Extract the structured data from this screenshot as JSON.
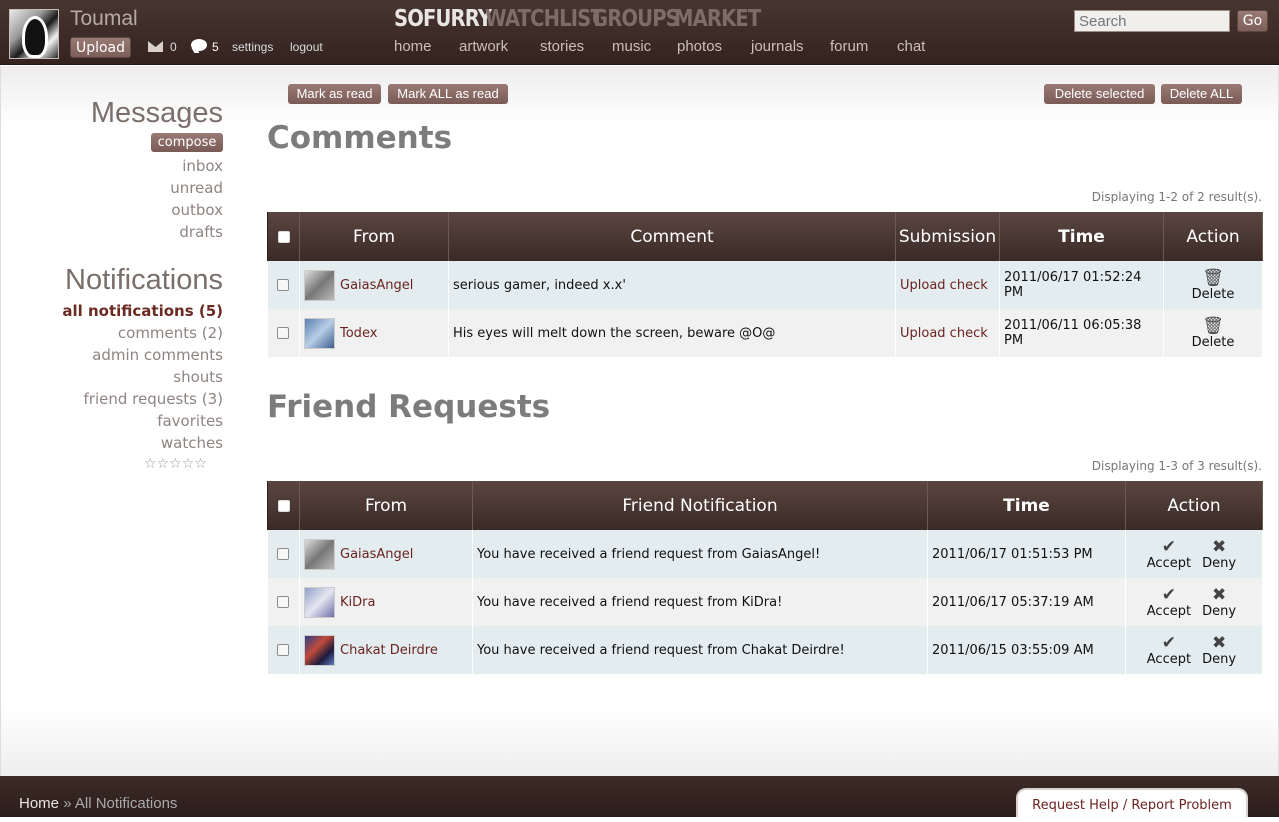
{
  "header": {
    "username": "Toumal",
    "upload_label": "Upload",
    "mail_count": "0",
    "comment_count": "5",
    "settings_label": "settings",
    "logout_label": "logout",
    "brand_nav": [
      "SOFURRY",
      "WATCHLIST",
      "GROUPS",
      "MARKET"
    ],
    "sub_nav": [
      "home",
      "artwork",
      "stories",
      "music",
      "photos",
      "journals",
      "forum",
      "chat"
    ],
    "search_placeholder": "Search",
    "go_label": "Go"
  },
  "sidebar": {
    "messages_title": "Messages",
    "compose_label": "compose",
    "message_links": [
      "inbox",
      "unread",
      "outbox",
      "drafts"
    ],
    "notifications_title": "Notifications",
    "notification_links": [
      "all notifications (5)",
      "comments (2)",
      "admin comments",
      "shouts",
      "friend requests (3)",
      "favorites",
      "watches"
    ],
    "rating": "☆☆☆☆☆"
  },
  "toolbar": {
    "mark_read": "Mark as read",
    "mark_all_read": "Mark ALL as read",
    "delete_selected": "Delete selected",
    "delete_all": "Delete ALL"
  },
  "comments": {
    "title": "Comments",
    "displaying": "Displaying 1-2 of 2 result(s).",
    "headers": [
      "From",
      "Comment",
      "Submission",
      "Time",
      "Action"
    ],
    "rows": [
      {
        "from": "GaiasAngel",
        "comment": "serious gamer, indeed x.x'",
        "submission": "Upload check",
        "time": "2011/06/17 01:52:24 PM",
        "action": "Delete"
      },
      {
        "from": "Todex",
        "comment": "His eyes will melt down the screen, beware @O@",
        "submission": "Upload check",
        "time": "2011/06/11 06:05:38 PM",
        "action": "Delete"
      }
    ]
  },
  "friend_requests": {
    "title": "Friend Requests",
    "displaying": "Displaying 1-3 of 3 result(s).",
    "headers": [
      "From",
      "Friend Notification",
      "Time",
      "Action"
    ],
    "accept_label": "Accept",
    "deny_label": "Deny",
    "rows": [
      {
        "from": "GaiasAngel",
        "notification": "You have received a friend request from GaiasAngel!",
        "time": "2011/06/17 01:51:53 PM"
      },
      {
        "from": "KiDra",
        "notification": "You have received a friend request from KiDra!",
        "time": "2011/06/17 05:37:19 AM"
      },
      {
        "from": "Chakat Deirdre",
        "notification": "You have received a friend request from Chakat Deirdre!",
        "time": "2011/06/15 03:55:09 AM"
      }
    ]
  },
  "footer": {
    "home_label": "Home",
    "separator": "»",
    "current": "All Notifications",
    "help_label": "Request Help",
    "help_sep": "/",
    "report_label": "Report Problem"
  }
}
